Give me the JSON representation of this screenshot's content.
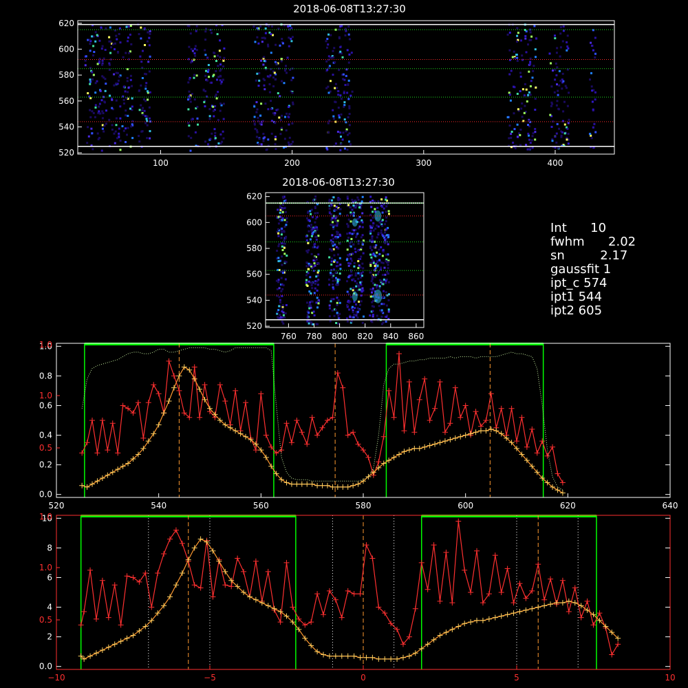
{
  "colors": {
    "axis_white": "#ffffff",
    "axis_red": "#ff3030",
    "green": "#00ff00",
    "orange": "#ff9a30",
    "yellow_plus": "#ffd060",
    "dotted_green": "#c8f0a0",
    "red_dotted": "#ff2a2a",
    "grid_green": "#20e020"
  },
  "info": [
    {
      "key": "Int",
      "value": "10"
    },
    {
      "key": "fwhm",
      "value": "2.02"
    },
    {
      "key": "sn",
      "value": "2.17"
    },
    {
      "key": "gaussfit",
      "value": "1"
    },
    {
      "key": "ipt_c",
      "value": "574"
    },
    {
      "key": "ipt1",
      "value": "544"
    },
    {
      "key": "ipt2",
      "value": "605"
    }
  ],
  "chart_data": [
    {
      "id": "slit-wide",
      "type": "heatmap",
      "title": "2018-06-08T13:27:30",
      "xlim": [
        37,
        445
      ],
      "ylim": [
        519,
        622
      ],
      "xticks": [
        "100",
        "200",
        "300",
        "400"
      ],
      "yticks": [
        "520",
        "540",
        "560",
        "580",
        "600",
        "620"
      ],
      "bands": [
        [
          42,
          58
        ],
        [
          60,
          78
        ],
        [
          82,
          92
        ],
        [
          120,
          128
        ],
        [
          132,
          148
        ],
        [
          170,
          190
        ],
        [
          190,
          200
        ],
        [
          225,
          245
        ],
        [
          363,
          385
        ],
        [
          395,
          410
        ],
        [
          425,
          430
        ]
      ],
      "hlines_white": [
        525,
        619
      ],
      "hlines_green": [
        563,
        585,
        615
      ],
      "hlines_red": [
        544,
        592
      ]
    },
    {
      "id": "slit-zoom",
      "type": "heatmap",
      "title": "2018-06-08T13:27:30",
      "xlim": [
        742,
        866
      ],
      "ylim": [
        519,
        623
      ],
      "xticks": [
        "760",
        "780",
        "800",
        "820",
        "840",
        "860"
      ],
      "yticks": [
        "520",
        "540",
        "560",
        "580",
        "600",
        "620"
      ],
      "bands": [
        [
          750,
          758
        ],
        [
          773,
          783
        ],
        [
          791,
          800
        ],
        [
          805,
          818
        ],
        [
          823,
          838
        ]
      ],
      "hlines_white": [
        525,
        615
      ],
      "hlines_green": [
        563,
        585,
        615
      ],
      "hlines_red": [
        544,
        605
      ]
    },
    {
      "id": "profile-pixel",
      "type": "line",
      "xlim": [
        520,
        640
      ],
      "ylim": [
        -0.02,
        1.02
      ],
      "xticks": [
        "520",
        "540",
        "560",
        "580",
        "600",
        "620",
        "640"
      ],
      "yticks_white": [
        "0.0",
        "0.2",
        "0.4",
        "0.6",
        "0.8",
        "1.0"
      ],
      "yticks_red": [
        "0.5",
        "1.0"
      ],
      "green_boxes": [
        [
          525.5,
          562.5
        ],
        [
          584.5,
          615.2
        ]
      ],
      "vlines_dashed": [
        544,
        574.5,
        604.8
      ],
      "x": [
        525,
        526,
        527,
        528,
        529,
        530,
        531,
        532,
        533,
        534,
        535,
        536,
        537,
        538,
        539,
        540,
        541,
        542,
        543,
        544,
        545,
        546,
        547,
        548,
        549,
        550,
        551,
        552,
        553,
        554,
        555,
        556,
        557,
        558,
        559,
        560,
        561,
        562,
        563,
        564,
        565,
        566,
        567,
        568,
        569,
        570,
        571,
        572,
        573,
        574,
        575,
        576,
        577,
        578,
        579,
        580,
        581,
        582,
        583,
        584,
        585,
        586,
        587,
        588,
        589,
        590,
        591,
        592,
        593,
        594,
        595,
        596,
        597,
        598,
        599,
        600,
        601,
        602,
        603,
        604,
        605,
        606,
        607,
        608,
        609,
        610,
        611,
        612,
        613,
        614,
        615,
        616,
        617,
        618,
        619
      ],
      "series": [
        {
          "key": "red",
          "values": [
            0.28,
            0.35,
            0.5,
            0.28,
            0.5,
            0.3,
            0.48,
            0.28,
            0.6,
            0.58,
            0.55,
            0.62,
            0.38,
            0.62,
            0.74,
            0.68,
            0.55,
            0.9,
            0.8,
            0.7,
            0.55,
            0.52,
            0.86,
            0.52,
            0.74,
            0.56,
            0.52,
            0.74,
            0.63,
            0.47,
            0.7,
            0.43,
            0.62,
            0.38,
            0.3,
            0.68,
            0.4,
            0.32,
            0.28,
            0.3,
            0.48,
            0.35,
            0.5,
            0.42,
            0.34,
            0.52,
            0.4,
            0.45,
            0.5,
            0.52,
            0.82,
            0.72,
            0.4,
            0.42,
            0.34,
            0.3,
            0.25,
            0.13,
            0.22,
            0.39,
            0.7,
            0.52,
            0.95,
            0.43,
            0.76,
            0.42,
            0.64,
            0.78,
            0.5,
            0.58,
            0.76,
            0.42,
            0.48,
            0.72,
            0.52,
            0.6,
            0.4,
            0.56,
            0.46,
            0.5,
            0.68,
            0.45,
            0.58,
            0.4,
            0.58,
            0.36,
            0.52,
            0.32,
            0.44,
            0.28,
            0.36,
            0.26,
            0.32,
            0.14,
            0.08
          ],
          "color": "#ff3030"
        },
        {
          "key": "fit",
          "values": [
            0.06,
            0.05,
            0.07,
            0.09,
            0.11,
            0.13,
            0.15,
            0.17,
            0.19,
            0.21,
            0.24,
            0.27,
            0.31,
            0.36,
            0.41,
            0.47,
            0.55,
            0.63,
            0.72,
            0.8,
            0.86,
            0.84,
            0.78,
            0.71,
            0.64,
            0.58,
            0.54,
            0.5,
            0.47,
            0.45,
            0.43,
            0.41,
            0.39,
            0.37,
            0.34,
            0.3,
            0.25,
            0.19,
            0.14,
            0.1,
            0.08,
            0.07,
            0.07,
            0.07,
            0.07,
            0.07,
            0.06,
            0.06,
            0.06,
            0.05,
            0.05,
            0.05,
            0.05,
            0.06,
            0.07,
            0.09,
            0.12,
            0.15,
            0.18,
            0.21,
            0.23,
            0.25,
            0.27,
            0.29,
            0.3,
            0.31,
            0.31,
            0.32,
            0.33,
            0.34,
            0.35,
            0.36,
            0.37,
            0.38,
            0.39,
            0.4,
            0.41,
            0.42,
            0.43,
            0.43,
            0.44,
            0.43,
            0.41,
            0.38,
            0.35,
            0.31,
            0.27,
            0.23,
            0.19,
            0.15,
            0.11,
            0.08,
            0.05,
            0.03,
            0.01
          ],
          "color": "#ff9a30"
        },
        {
          "key": "throughput",
          "values": [
            0.58,
            0.78,
            0.85,
            0.87,
            0.88,
            0.89,
            0.9,
            0.91,
            0.93,
            0.95,
            0.96,
            0.96,
            0.95,
            0.95,
            0.96,
            0.98,
            0.98,
            0.96,
            0.96,
            0.97,
            0.98,
            0.99,
            0.99,
            0.99,
            0.99,
            0.98,
            0.98,
            0.97,
            0.96,
            0.97,
            0.99,
            0.99,
            0.99,
            0.99,
            0.99,
            0.99,
            0.99,
            0.97,
            0.6,
            0.25,
            0.15,
            0.11,
            0.1,
            0.1,
            0.1,
            0.09,
            0.09,
            0.09,
            0.09,
            0.09,
            0.09,
            0.09,
            0.09,
            0.09,
            0.09,
            0.1,
            0.12,
            0.18,
            0.4,
            0.74,
            0.85,
            0.88,
            0.88,
            0.89,
            0.9,
            0.9,
            0.91,
            0.91,
            0.92,
            0.92,
            0.92,
            0.92,
            0.93,
            0.92,
            0.93,
            0.93,
            0.93,
            0.92,
            0.93,
            0.93,
            0.93,
            0.93,
            0.94,
            0.95,
            0.96,
            0.95,
            0.95,
            0.94,
            0.93,
            0.85,
            0.6,
            0.3,
            0.12,
            0.05,
            0.03
          ],
          "color": "#c8f0a0"
        }
      ]
    },
    {
      "id": "profile-offset",
      "type": "line",
      "xlim": [
        -10,
        10
      ],
      "ylim": [
        -0.2,
        10.2
      ],
      "xticks": [
        "−10",
        "−5",
        "0",
        "5",
        "10"
      ],
      "yticks_white": [
        "0.0",
        "2",
        "4",
        "6",
        "8",
        "10"
      ],
      "yticks_red": [
        "0.5",
        "1.0"
      ],
      "green_boxes": [
        [
          -9.2,
          -2.2
        ],
        [
          1.9,
          7.6
        ]
      ],
      "vlines_dashed": [
        -5.7,
        0.0,
        5.7
      ],
      "vlines_dotted": [
        -7.0,
        -5.0,
        -1.0,
        1.0,
        5.0,
        7.0
      ],
      "x": [
        -9.2,
        -9.1,
        -8.9,
        -8.7,
        -8.5,
        -8.3,
        -8.1,
        -7.9,
        -7.7,
        -7.5,
        -7.3,
        -7.1,
        -6.9,
        -6.7,
        -6.5,
        -6.3,
        -6.1,
        -5.9,
        -5.7,
        -5.5,
        -5.3,
        -5.1,
        -4.9,
        -4.7,
        -4.5,
        -4.3,
        -4.1,
        -3.9,
        -3.7,
        -3.5,
        -3.3,
        -3.1,
        -2.9,
        -2.7,
        -2.5,
        -2.3,
        -2.1,
        -1.9,
        -1.7,
        -1.5,
        -1.3,
        -1.1,
        -0.9,
        -0.7,
        -0.5,
        -0.3,
        -0.1,
        0.1,
        0.3,
        0.5,
        0.7,
        0.9,
        1.1,
        1.3,
        1.5,
        1.7,
        1.9,
        2.1,
        2.3,
        2.5,
        2.7,
        2.9,
        3.1,
        3.3,
        3.5,
        3.7,
        3.9,
        4.1,
        4.3,
        4.5,
        4.7,
        4.9,
        5.1,
        5.3,
        5.5,
        5.7,
        5.9,
        6.1,
        6.3,
        6.5,
        6.7,
        6.9,
        7.1,
        7.3,
        7.5,
        7.7,
        7.9,
        8.1,
        8.3
      ],
      "series": [
        {
          "key": "red",
          "values": [
            2.8,
            3.7,
            6.5,
            3.2,
            5.8,
            3.3,
            5.5,
            2.8,
            6.1,
            6.0,
            5.7,
            6.3,
            4.0,
            6.3,
            7.6,
            8.6,
            9.2,
            8.3,
            7.1,
            5.5,
            5.3,
            8.5,
            4.7,
            7.2,
            5.5,
            5.4,
            7.3,
            6.4,
            4.7,
            7.1,
            4.4,
            6.4,
            3.8,
            3.0,
            7.0,
            4.0,
            3.2,
            2.8,
            3.0,
            4.9,
            3.5,
            5.1,
            4.5,
            3.3,
            5.1,
            4.9,
            4.9,
            8.2,
            7.3,
            4.0,
            3.6,
            2.9,
            2.5,
            1.5,
            2.0,
            3.9,
            7.0,
            5.2,
            8.2,
            4.4,
            7.7,
            4.3,
            9.8,
            6.5,
            5.0,
            7.8,
            4.3,
            4.9,
            7.5,
            5.0,
            6.6,
            4.3,
            5.6,
            4.6,
            5.1,
            6.9,
            4.5,
            5.9,
            4.2,
            5.8,
            3.7,
            5.3,
            3.3,
            4.4,
            2.8,
            3.6,
            2.6,
            0.8,
            1.5
          ],
          "color": "#ff3030"
        },
        {
          "key": "fit",
          "values": [
            0.7,
            0.5,
            0.7,
            0.9,
            1.1,
            1.3,
            1.5,
            1.7,
            1.9,
            2.1,
            2.4,
            2.7,
            3.1,
            3.6,
            4.1,
            4.7,
            5.5,
            6.3,
            7.2,
            8.0,
            8.6,
            8.4,
            7.8,
            7.1,
            6.4,
            5.8,
            5.4,
            5.0,
            4.7,
            4.5,
            4.3,
            4.1,
            3.9,
            3.7,
            3.4,
            3.0,
            2.5,
            1.9,
            1.4,
            1.0,
            0.8,
            0.7,
            0.7,
            0.7,
            0.7,
            0.7,
            0.6,
            0.6,
            0.6,
            0.5,
            0.5,
            0.5,
            0.5,
            0.6,
            0.7,
            0.9,
            1.2,
            1.5,
            1.8,
            2.1,
            2.3,
            2.5,
            2.7,
            2.9,
            3.0,
            3.1,
            3.1,
            3.2,
            3.3,
            3.4,
            3.5,
            3.6,
            3.7,
            3.8,
            3.9,
            4.0,
            4.1,
            4.2,
            4.3,
            4.3,
            4.4,
            4.3,
            4.1,
            3.8,
            3.5,
            3.1,
            2.7,
            2.3,
            1.9
          ],
          "color": "#ff9a30"
        }
      ]
    }
  ]
}
